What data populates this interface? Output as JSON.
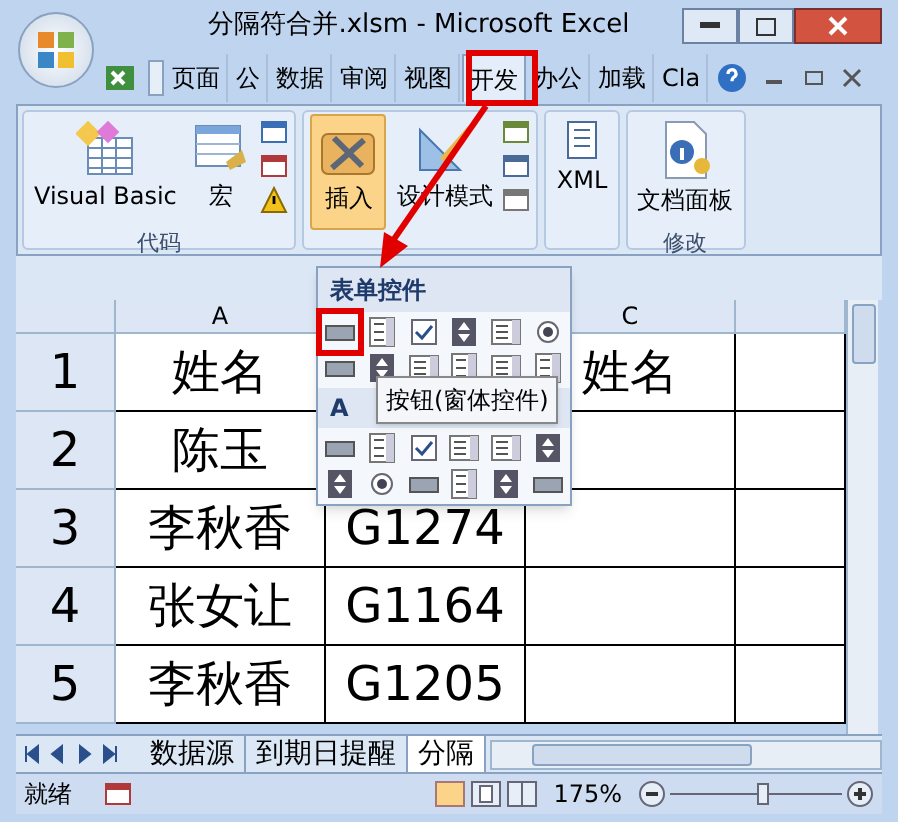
{
  "window": {
    "title": "分隔符合并.xlsm - Microsoft Excel"
  },
  "ribbon_tabs": [
    {
      "label": "页面",
      "selected": false
    },
    {
      "label": "公",
      "selected": false
    },
    {
      "label": "数据",
      "selected": false
    },
    {
      "label": "审阅",
      "selected": false
    },
    {
      "label": "视图",
      "selected": false
    },
    {
      "label": "开发",
      "selected": true
    },
    {
      "label": "办公",
      "selected": false
    },
    {
      "label": "加载",
      "selected": false
    },
    {
      "label": "Cla",
      "selected": false
    }
  ],
  "ribbon_groups": [
    {
      "label": "代码",
      "buttons": [
        {
          "label": "Visual Basic",
          "kind": "vb",
          "selected": false
        },
        {
          "label": "宏",
          "kind": "macro",
          "selected": false
        }
      ]
    },
    {
      "buttons": [
        {
          "label": "插入",
          "kind": "insert",
          "selected": true
        },
        {
          "label": "设计模式",
          "kind": "design",
          "selected": false
        }
      ]
    },
    {
      "buttons": [
        {
          "label": "XML",
          "kind": "xml",
          "selected": false
        }
      ]
    },
    {
      "label": "修改",
      "buttons": [
        {
          "label": "文档面板",
          "kind": "panel",
          "selected": false
        }
      ]
    }
  ],
  "dropdown": {
    "header": "表单控件",
    "section_2_header": "A",
    "tooltip": "按钮(窗体控件)"
  },
  "column_headers": {
    "column_1": "A",
    "column_3": "C"
  },
  "rows": [
    {
      "header": "1",
      "cells": [
        "姓名",
        null,
        "姓名"
      ]
    },
    {
      "header": "2",
      "cells": [
        "陈玉",
        null,
        null
      ]
    },
    {
      "header": "3",
      "cells": [
        "李秋香",
        "G1274",
        null
      ]
    },
    {
      "header": "4",
      "cells": [
        "张女让",
        "G1164",
        null
      ]
    },
    {
      "header": "5",
      "cells": [
        "李秋香",
        "G1205",
        null
      ]
    }
  ],
  "sheet_tabs": [
    {
      "label": "数据源",
      "selected": false
    },
    {
      "label": "到期日提醒",
      "selected": false
    },
    {
      "label": "分隔",
      "selected": true
    }
  ],
  "status_bar": {
    "status": "就绪",
    "zoom": "175%",
    "zoom_slider": {
      "level": 0.55
    }
  }
}
